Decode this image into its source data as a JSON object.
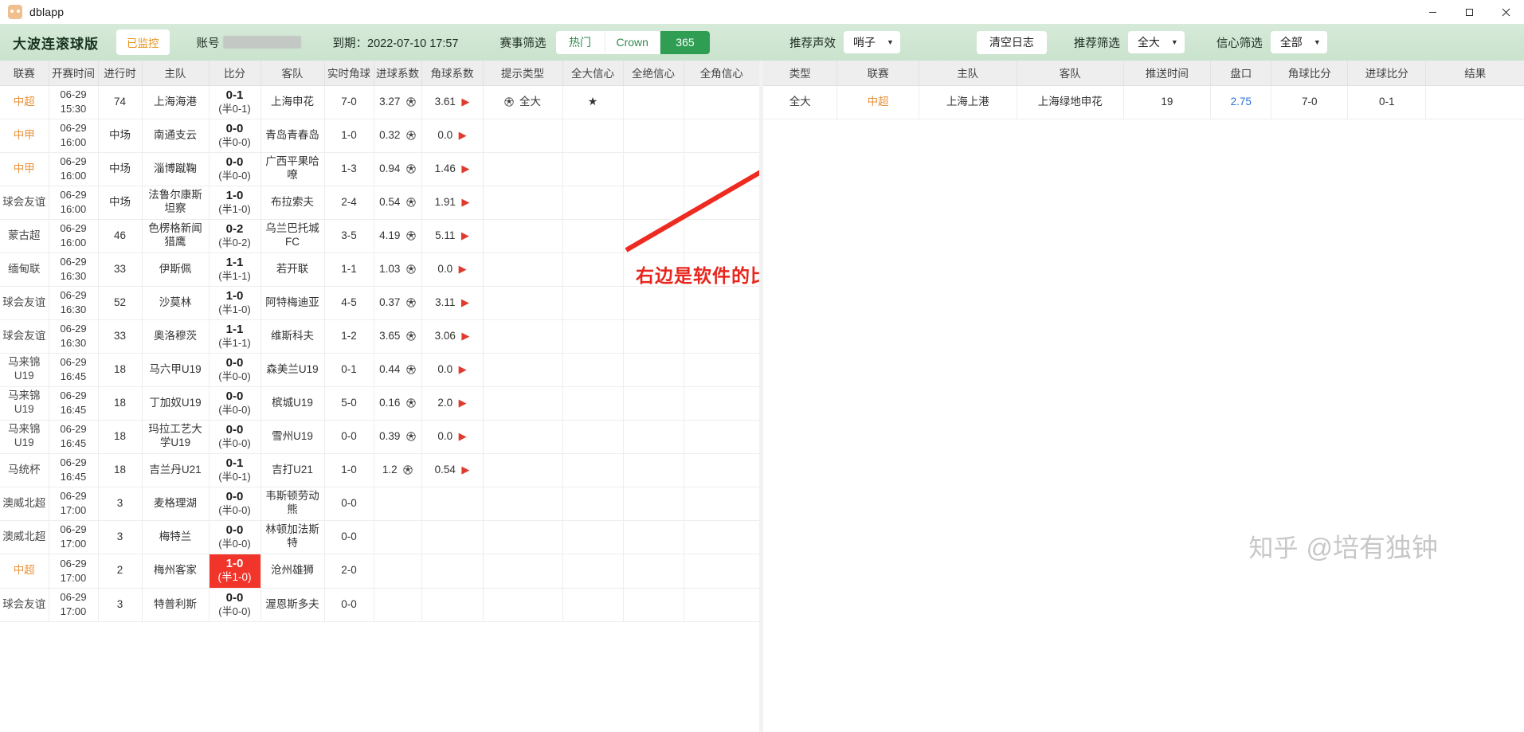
{
  "window": {
    "app_name": "dblapp",
    "icon": "app-logo-icon",
    "minimize": "–",
    "maximize": "▢",
    "close": "✕"
  },
  "toolbar": {
    "brand": "大波连滚球版",
    "monitor_status": "已监控",
    "account_label": "账号",
    "expiry": "到期：2022-07-10 17:57",
    "match_filter_label": "赛事筛选",
    "match_filter_options": [
      "热门",
      "Crown",
      "365"
    ],
    "match_filter_active": "365",
    "sound_label": "推荐声效",
    "sound_value": "哨子",
    "clear_log": "清空日志",
    "recommend_filter_label": "推荐筛选",
    "recommend_filter_value": "全大",
    "confidence_filter_label": "信心筛选",
    "confidence_filter_value": "全部",
    "caret": "▼"
  },
  "left_table": {
    "headers": [
      "联赛",
      "开赛时间",
      "进行时",
      "主队",
      "比分",
      "客队",
      "实时角球",
      "进球系数",
      "角球系数",
      "提示类型",
      "全大信心",
      "全绝信心",
      "全角信心"
    ],
    "rows": [
      {
        "league": "中超",
        "league_color": "orange",
        "date": "06-29",
        "time": "15:30",
        "minute": "74",
        "home": "上海海港",
        "score": "0-1",
        "half": "(半0-1)",
        "away": "上海申花",
        "corner": "7-0",
        "goal_coef": "3.27",
        "corner_coef": "3.61",
        "flag": true,
        "hint": "全大",
        "c_big": "★",
        "c_abs": "",
        "c_cor": "",
        "hot": false
      },
      {
        "league": "中甲",
        "league_color": "orange",
        "date": "06-29",
        "time": "16:00",
        "minute": "中场",
        "home": "南通支云",
        "score": "0-0",
        "half": "(半0-0)",
        "away": "青岛青春岛",
        "corner": "1-0",
        "goal_coef": "0.32",
        "corner_coef": "0.0",
        "flag": true,
        "hint": "",
        "c_big": "",
        "c_abs": "",
        "c_cor": "",
        "hot": false
      },
      {
        "league": "中甲",
        "league_color": "orange",
        "date": "06-29",
        "time": "16:00",
        "minute": "中场",
        "home": "淄博蹴鞠",
        "score": "0-0",
        "half": "(半0-0)",
        "away": "广西平果哈嘹",
        "corner": "1-3",
        "goal_coef": "0.94",
        "corner_coef": "1.46",
        "flag": true,
        "hint": "",
        "c_big": "",
        "c_abs": "",
        "c_cor": "",
        "hot": false
      },
      {
        "league": "球会友谊",
        "league_color": "gray",
        "date": "06-29",
        "time": "16:00",
        "minute": "中场",
        "home": "法鲁尔康斯坦察",
        "score": "1-0",
        "half": "(半1-0)",
        "away": "布拉索夫",
        "corner": "2-4",
        "goal_coef": "0.54",
        "corner_coef": "1.91",
        "flag": true,
        "hint": "",
        "c_big": "",
        "c_abs": "",
        "c_cor": "",
        "hot": false
      },
      {
        "league": "蒙古超",
        "league_color": "gray",
        "date": "06-29",
        "time": "16:00",
        "minute": "46",
        "home": "色楞格新闻猎鹰",
        "score": "0-2",
        "half": "(半0-2)",
        "away": "乌兰巴托城FC",
        "corner": "3-5",
        "goal_coef": "4.19",
        "corner_coef": "5.11",
        "flag": true,
        "hint": "",
        "c_big": "",
        "c_abs": "",
        "c_cor": "",
        "hot": false
      },
      {
        "league": "缅甸联",
        "league_color": "gray",
        "date": "06-29",
        "time": "16:30",
        "minute": "33",
        "home": "伊斯佩",
        "score": "1-1",
        "half": "(半1-1)",
        "away": "若开联",
        "corner": "1-1",
        "goal_coef": "1.03",
        "corner_coef": "0.0",
        "flag": true,
        "hint": "",
        "c_big": "",
        "c_abs": "",
        "c_cor": "",
        "hot": false
      },
      {
        "league": "球会友谊",
        "league_color": "gray",
        "date": "06-29",
        "time": "16:30",
        "minute": "52",
        "home": "沙莫林",
        "score": "1-0",
        "half": "(半1-0)",
        "away": "阿特梅迪亚",
        "corner": "4-5",
        "goal_coef": "0.37",
        "corner_coef": "3.11",
        "flag": true,
        "hint": "",
        "c_big": "",
        "c_abs": "",
        "c_cor": "",
        "hot": false
      },
      {
        "league": "球会友谊",
        "league_color": "gray",
        "date": "06-29",
        "time": "16:30",
        "minute": "33",
        "home": "奥洛穆茨",
        "score": "1-1",
        "half": "(半1-1)",
        "away": "维斯科夫",
        "corner": "1-2",
        "goal_coef": "3.65",
        "corner_coef": "3.06",
        "flag": true,
        "hint": "",
        "c_big": "",
        "c_abs": "",
        "c_cor": "",
        "hot": false
      },
      {
        "league": "马来锦U19",
        "league_color": "gray",
        "date": "06-29",
        "time": "16:45",
        "minute": "18",
        "home": "马六甲U19",
        "score": "0-0",
        "half": "(半0-0)",
        "away": "森美兰U19",
        "corner": "0-1",
        "goal_coef": "0.44",
        "corner_coef": "0.0",
        "flag": true,
        "hint": "",
        "c_big": "",
        "c_abs": "",
        "c_cor": "",
        "hot": false
      },
      {
        "league": "马来锦U19",
        "league_color": "gray",
        "date": "06-29",
        "time": "16:45",
        "minute": "18",
        "home": "丁加奴U19",
        "score": "0-0",
        "half": "(半0-0)",
        "away": "槟城U19",
        "corner": "5-0",
        "goal_coef": "0.16",
        "corner_coef": "2.0",
        "flag": true,
        "hint": "",
        "c_big": "",
        "c_abs": "",
        "c_cor": "",
        "hot": false
      },
      {
        "league": "马来锦U19",
        "league_color": "gray",
        "date": "06-29",
        "time": "16:45",
        "minute": "18",
        "home": "玛拉工艺大学U19",
        "score": "0-0",
        "half": "(半0-0)",
        "away": "雪州U19",
        "corner": "0-0",
        "goal_coef": "0.39",
        "corner_coef": "0.0",
        "flag": true,
        "hint": "",
        "c_big": "",
        "c_abs": "",
        "c_cor": "",
        "hot": false
      },
      {
        "league": "马统杯",
        "league_color": "gray",
        "date": "06-29",
        "time": "16:45",
        "minute": "18",
        "home": "吉兰丹U21",
        "score": "0-1",
        "half": "(半0-1)",
        "away": "吉打U21",
        "corner": "1-0",
        "goal_coef": "1.2",
        "corner_coef": "0.54",
        "flag": true,
        "hint": "",
        "c_big": "",
        "c_abs": "",
        "c_cor": "",
        "hot": false
      },
      {
        "league": "澳威北超",
        "league_color": "gray",
        "date": "06-29",
        "time": "17:00",
        "minute": "3",
        "home": "麦格理湖",
        "score": "0-0",
        "half": "(半0-0)",
        "away": "韦斯顿劳动熊",
        "corner": "0-0",
        "goal_coef": "",
        "corner_coef": "",
        "flag": false,
        "hint": "",
        "c_big": "",
        "c_abs": "",
        "c_cor": "",
        "hot": false
      },
      {
        "league": "澳威北超",
        "league_color": "gray",
        "date": "06-29",
        "time": "17:00",
        "minute": "3",
        "home": "梅特兰",
        "score": "0-0",
        "half": "(半0-0)",
        "away": "林顿加法斯特",
        "corner": "0-0",
        "goal_coef": "",
        "corner_coef": "",
        "flag": false,
        "hint": "",
        "c_big": "",
        "c_abs": "",
        "c_cor": "",
        "hot": false
      },
      {
        "league": "中超",
        "league_color": "orange",
        "date": "06-29",
        "time": "17:00",
        "minute": "2",
        "home": "梅州客家",
        "score": "1-0",
        "half": "(半1-0)",
        "away": "沧州雄狮",
        "corner": "2-0",
        "goal_coef": "",
        "corner_coef": "",
        "flag": false,
        "hint": "",
        "c_big": "",
        "c_abs": "",
        "c_cor": "",
        "hot": true
      },
      {
        "league": "球会友谊",
        "league_color": "gray",
        "date": "06-29",
        "time": "17:00",
        "minute": "3",
        "home": "特普利斯",
        "score": "0-0",
        "half": "(半0-0)",
        "away": "渥恩斯多夫",
        "corner": "0-0",
        "goal_coef": "",
        "corner_coef": "",
        "flag": false,
        "hint": "",
        "c_big": "",
        "c_abs": "",
        "c_cor": "",
        "hot": false
      }
    ]
  },
  "right_table": {
    "headers": [
      "类型",
      "联赛",
      "主队",
      "客队",
      "推送时间",
      "盘口",
      "角球比分",
      "进球比分",
      "结果"
    ],
    "rows": [
      {
        "type": "全大",
        "league": "中超",
        "home": "上海上港",
        "away": "上海绿地申花",
        "push_time": "19",
        "handicap": "2.75",
        "corner_score": "7-0",
        "goal_score": "0-1",
        "result": ""
      }
    ]
  },
  "annotation": {
    "text": "右边是软件的比赛预测",
    "color": "#e8251c",
    "arrow": "red-arrow-icon"
  },
  "watermark": {
    "logo": "知乎",
    "text": "@培有独钟"
  }
}
